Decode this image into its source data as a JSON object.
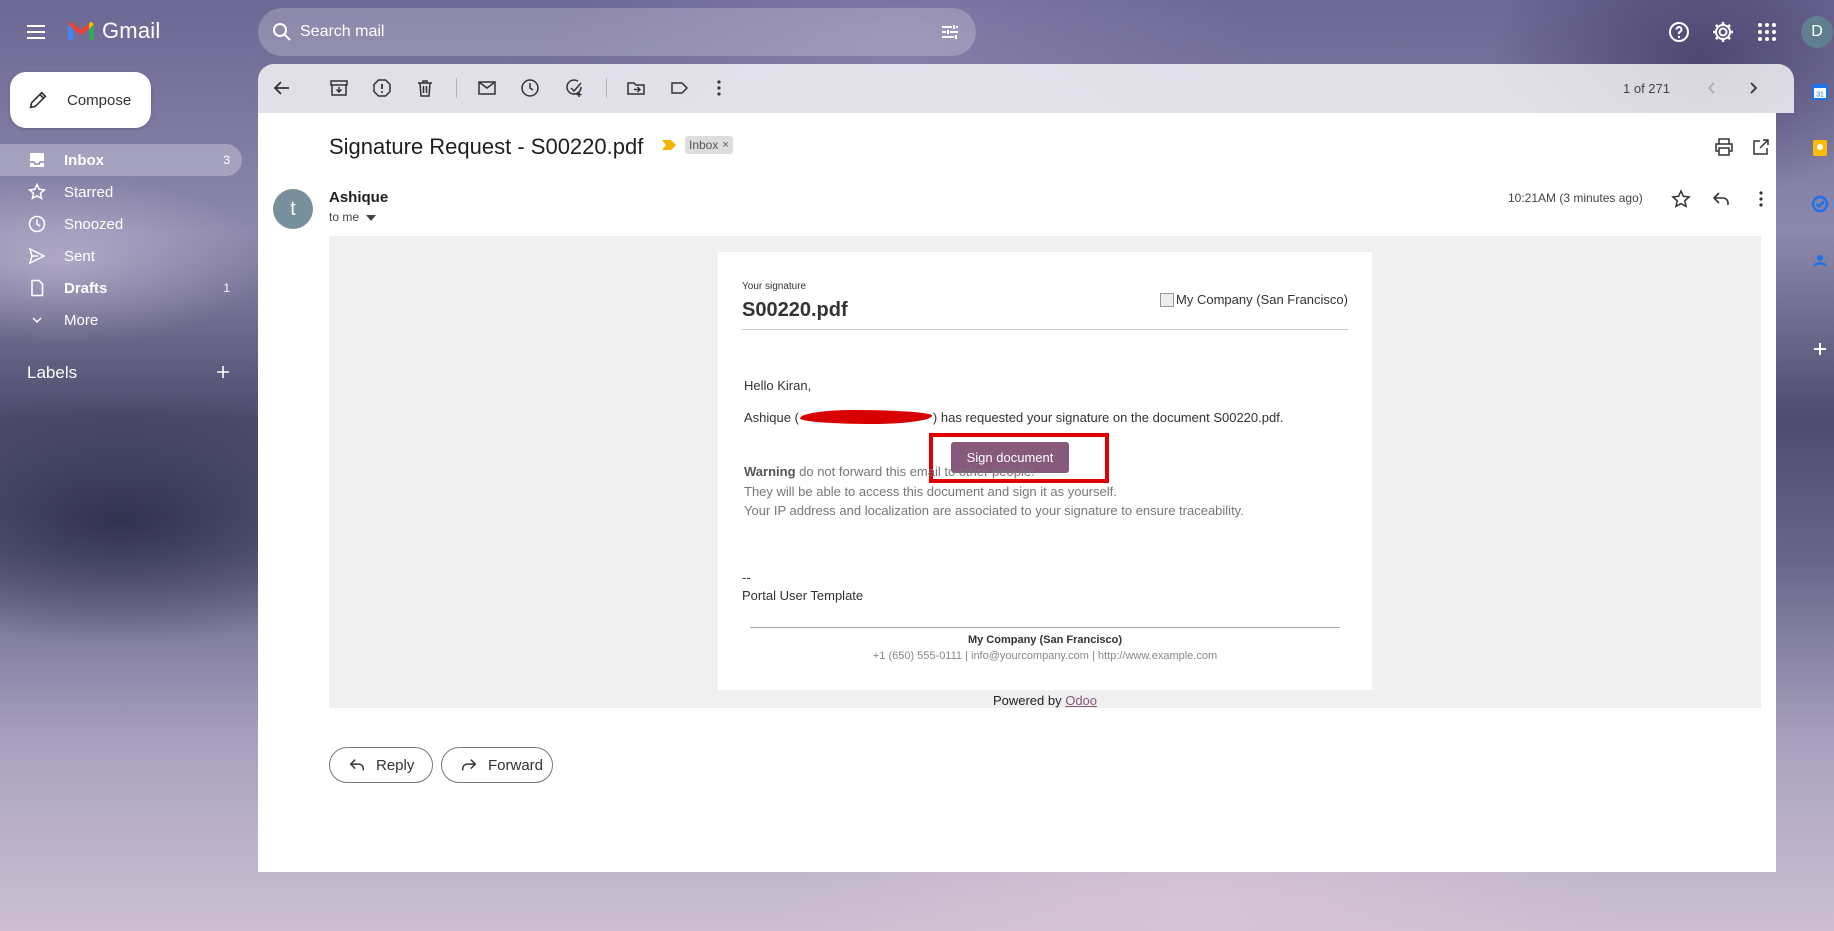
{
  "app": {
    "name": "Gmail",
    "avatar_initial": "D"
  },
  "search": {
    "placeholder": "Search mail"
  },
  "sidebar": {
    "compose_label": "Compose",
    "items": [
      {
        "label": "Inbox",
        "count": "3"
      },
      {
        "label": "Starred",
        "count": ""
      },
      {
        "label": "Snoozed",
        "count": ""
      },
      {
        "label": "Sent",
        "count": ""
      },
      {
        "label": "Drafts",
        "count": "1"
      },
      {
        "label": "More",
        "count": ""
      }
    ],
    "labels_title": "Labels"
  },
  "toolbar": {
    "pager": "1 of 271"
  },
  "email": {
    "subject": "Signature Request - S00220.pdf",
    "badge": "Inbox",
    "badge_close": "×",
    "sender_initial": "t",
    "sender": "Ashique",
    "to": "to me",
    "timestamp": "10:21AM (3 minutes ago)"
  },
  "body": {
    "your_signature": "Your signature",
    "doc_title": "S00220.pdf",
    "company_logo_alt": "My Company (San Francisco)",
    "greeting": "Hello Kiran,",
    "request_prefix": "Ashique (",
    "request_suffix": ") has requested your signature on the document S00220.pdf.",
    "sign_button": "Sign document",
    "warning_bold": "Warning",
    "warning_text": " do not forward this email to other people!",
    "warning_line2": "They will be able to access this document and sign it as yourself.",
    "warning_line3": "Your IP address and localization are associated to your signature to ensure traceability.",
    "sig_dash": "--",
    "sig_name": "Portal User Template",
    "footer_company": "My Company (San Francisco)",
    "footer_contact": "+1 (650) 555-0111 | info@yourcompany.com | http://www.example.com",
    "powered_prefix": "Powered by ",
    "powered_link": "Odoo"
  },
  "actions": {
    "reply": "Reply",
    "forward": "Forward"
  },
  "colors": {
    "odoo_purple": "#875a7b",
    "highlight_red": "#e00000",
    "redaction": "#d80000"
  }
}
